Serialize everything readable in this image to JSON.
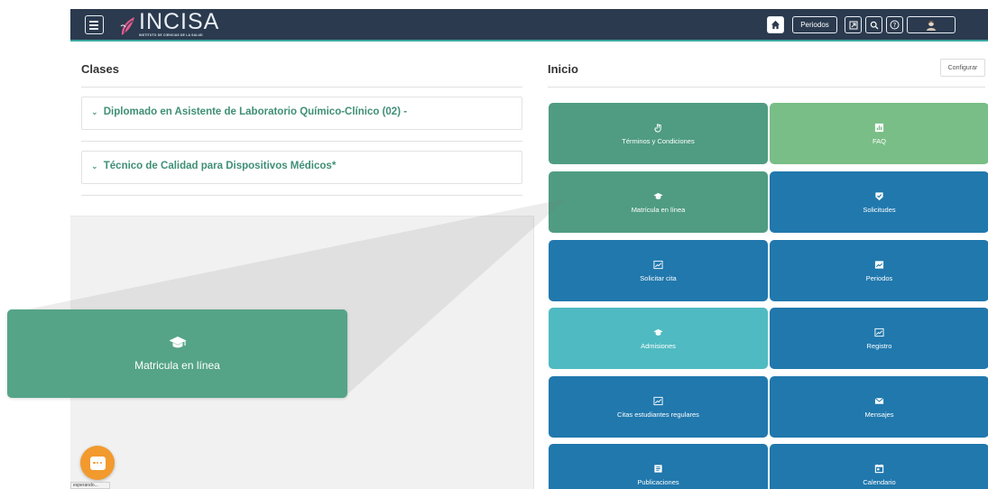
{
  "header": {
    "brand": "INCISA",
    "brand_tagline": "INSTITUTO DE CIENCIAS DE LA SALUD",
    "periods_button": "Periodos"
  },
  "left_panel": {
    "title": "Clases",
    "classes": [
      {
        "label": "Diplomado en Asistente de Laboratorio Químico-Clínico (02) -"
      },
      {
        "label": "Técnico de Calidad para Dispositivos Médicos*"
      }
    ]
  },
  "right_panel": {
    "title": "Inicio",
    "configure_button": "Configurar",
    "tiles": [
      {
        "label": "Términos y Condiciones",
        "icon": "hand-pointer-icon",
        "color": "#4f9c82"
      },
      {
        "label": "FAQ",
        "icon": "chart-icon",
        "color": "#79be86"
      },
      {
        "label": "Matrícula en línea",
        "icon": "graduation-cap-icon",
        "color": "#4f9c82"
      },
      {
        "label": "Solicitudes",
        "icon": "shield-check-icon",
        "color": "#2078ad"
      },
      {
        "label": "Solicitar cita",
        "icon": "line-chart-icon",
        "color": "#2078ad"
      },
      {
        "label": "Periodos",
        "icon": "calendar-image-icon",
        "color": "#2078ad"
      },
      {
        "label": "Admisiones",
        "icon": "graduation-cap-icon",
        "color": "#4fbac1"
      },
      {
        "label": "Registro",
        "icon": "line-chart-icon",
        "color": "#2078ad"
      },
      {
        "label": "Citas estudiantes regulares",
        "icon": "line-chart-icon",
        "color": "#2078ad"
      },
      {
        "label": "Mensajes",
        "icon": "envelope-icon",
        "color": "#2078ad"
      },
      {
        "label": "Publicaciones",
        "icon": "document-icon",
        "color": "#2078ad"
      },
      {
        "label": "Calendario",
        "icon": "calendar-icon",
        "color": "#2078ad"
      }
    ]
  },
  "zoom_callout": {
    "label": "Matricula en línea",
    "icon": "graduation-cap-icon",
    "color": "#55a487"
  },
  "chat": {
    "icon": "chat-bubble-icon",
    "color": "#f29a2e"
  },
  "status_chip": {
    "text": "esperando..."
  }
}
